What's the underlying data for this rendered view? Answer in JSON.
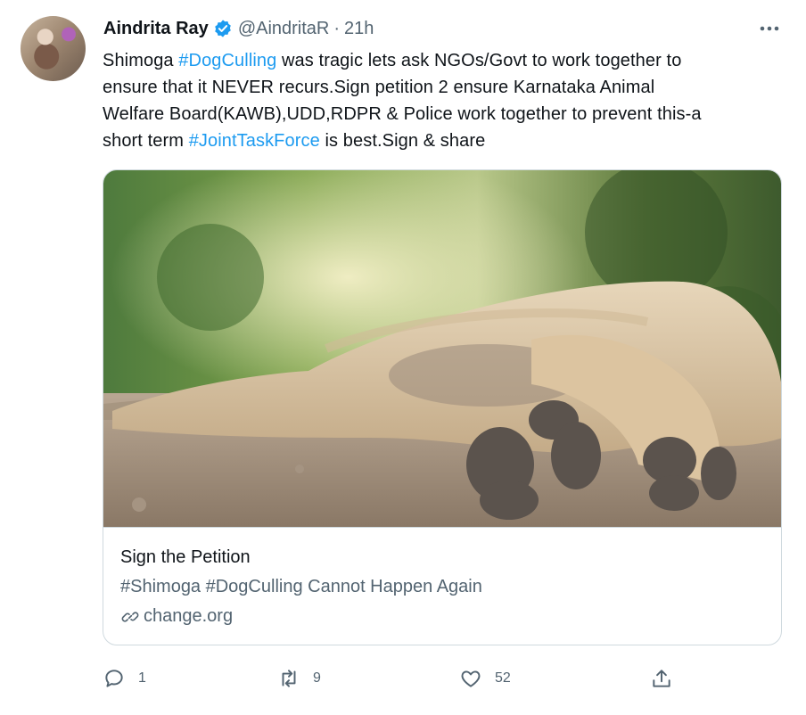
{
  "tweet": {
    "author_name": "Aindrita Ray",
    "handle": "@AindritaR",
    "separator": "·",
    "time": "21h",
    "text_lines": [
      [
        {
          "t": "Shimoga "
        },
        {
          "t": "#DogCulling",
          "tag": true
        },
        {
          "t": " was tragic lets ask NGOs/Govt to work together to"
        }
      ],
      [
        {
          "t": "ensure that it NEVER recurs.Sign petition 2 ensure Karnataka Animal"
        }
      ],
      [
        {
          "t": "Welfare Board(KAWB),UDD,RDPR & Police work together to prevent this-a"
        }
      ],
      [
        {
          "t": "short term "
        },
        {
          "t": "#JointTaskForce",
          "tag": true
        },
        {
          "t": " is best.Sign & share"
        }
      ]
    ]
  },
  "card": {
    "title": "Sign the Petition",
    "description": "#Shimoga #DogCulling Cannot Happen Again",
    "domain": "change.org"
  },
  "actions": {
    "reply_count": "1",
    "retweet_count": "9",
    "like_count": "52"
  },
  "colors": {
    "link": "#1d9bf0",
    "muted": "#536471",
    "border": "#cfd9de",
    "verified": "#1d9bf0"
  },
  "icons": [
    "avatar",
    "verified-badge-icon",
    "more-options-icon",
    "link-icon",
    "reply-icon",
    "retweet-icon",
    "like-icon",
    "share-icon"
  ]
}
